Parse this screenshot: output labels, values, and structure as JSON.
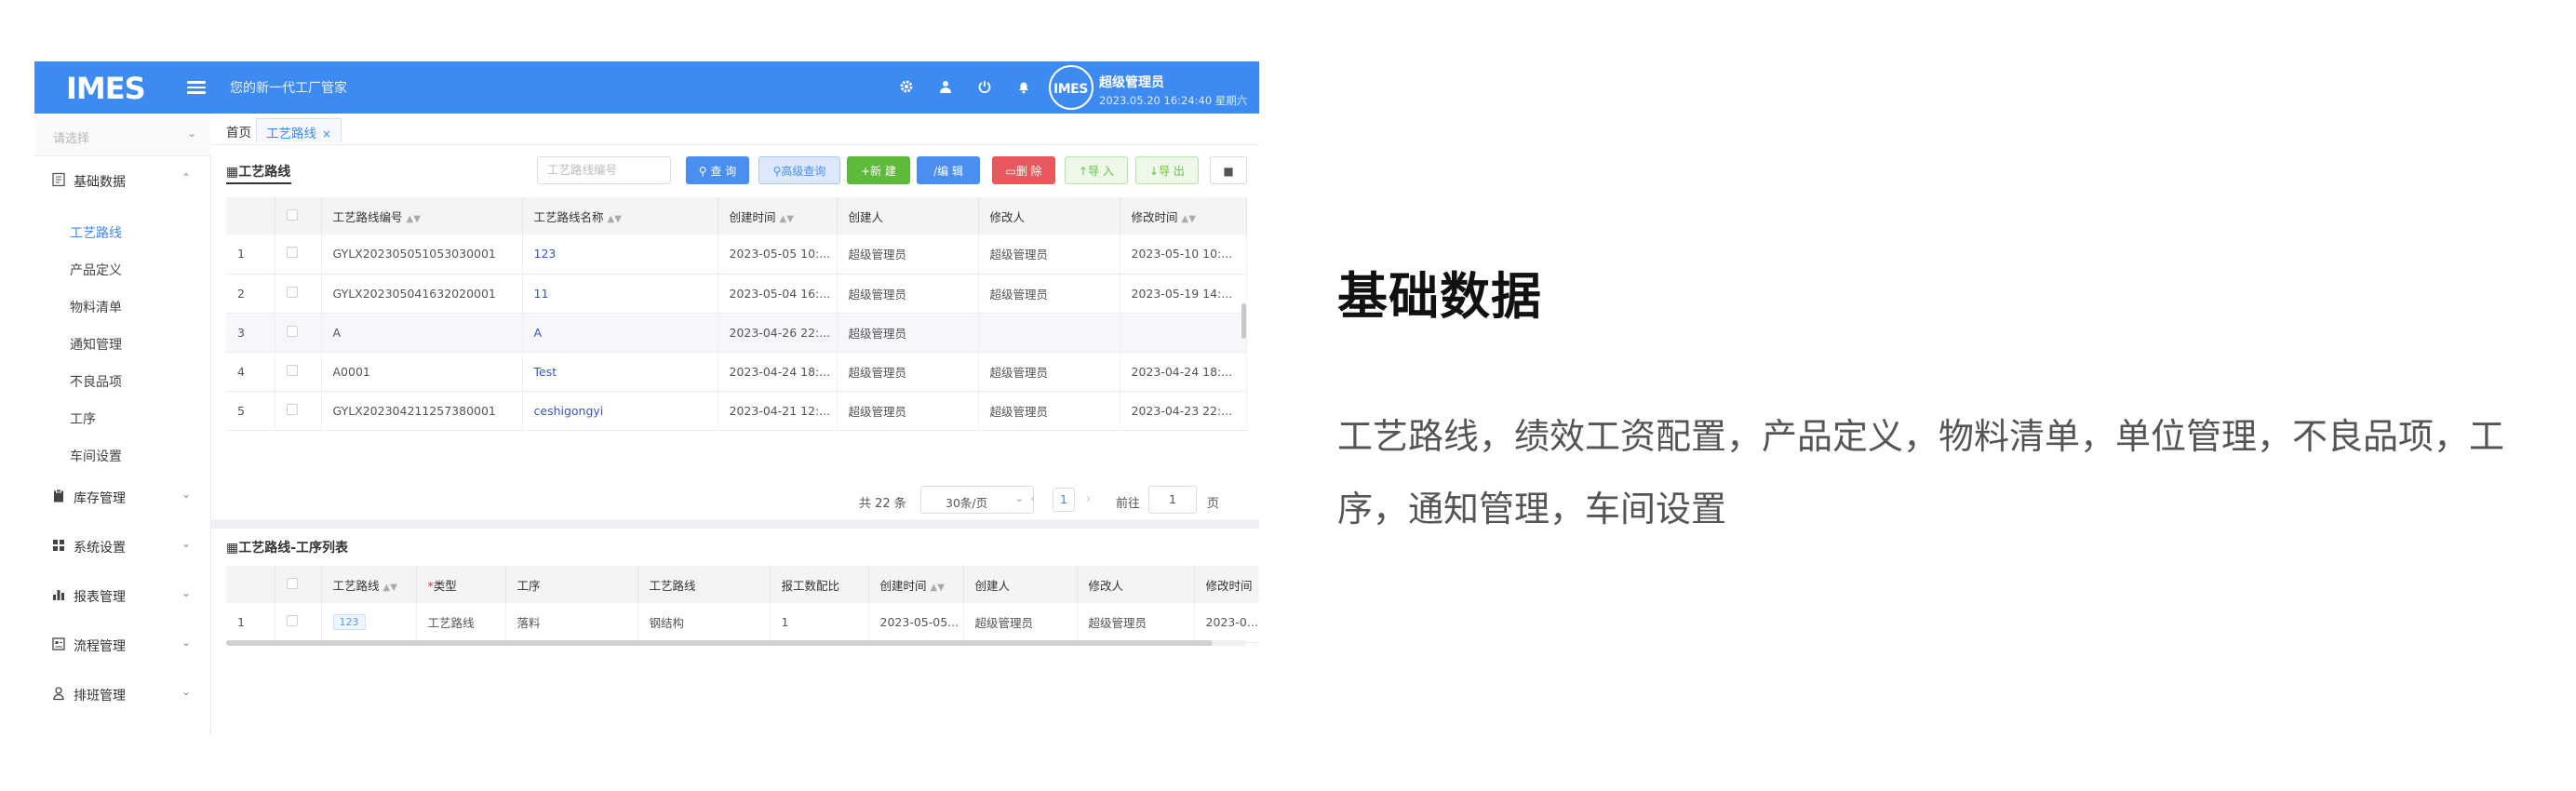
{
  "header": {
    "slogan": "您的新一代工厂管家",
    "user_name": "超级管理员",
    "datetime": "2023.05.20 16:24:40 星期六",
    "brand_color": "#3d8af1"
  },
  "sidebar": {
    "select_placeholder": "请选择",
    "groups": [
      {
        "label": "基础数据",
        "icon": "document-icon",
        "expanded": true,
        "items": [
          "工艺路线",
          "产品定义",
          "物料清单",
          "通知管理",
          "不良品项",
          "工序",
          "车间设置"
        ]
      },
      {
        "label": "库存管理",
        "icon": "clipboard-icon"
      },
      {
        "label": "系统设置",
        "icon": "grid-icon"
      },
      {
        "label": "报表管理",
        "icon": "bar-chart-icon"
      },
      {
        "label": "流程管理",
        "icon": "form-icon"
      },
      {
        "label": "排班管理",
        "icon": "person-icon"
      }
    ],
    "active_item": "工艺路线"
  },
  "tabs": {
    "home": "首页",
    "current": "工艺路线",
    "close": "×"
  },
  "panel": {
    "title": "工艺路线",
    "search_placeholder": "工艺路线编号",
    "buttons": {
      "query": "查 询",
      "advanced": "高级查询",
      "new": "新 建",
      "edit": "编 辑",
      "delete": "删 除",
      "import": "导 入",
      "export": "导 出"
    },
    "columns": [
      "工艺路线编号",
      "工艺路线名称",
      "创建时间",
      "创建人",
      "修改人",
      "修改时间"
    ],
    "rows": [
      {
        "no": "1",
        "code": "GYLX20230505105303000​1",
        "name": "123",
        "created": "2023-05-05 10:...",
        "creator": "超级管理员",
        "modifier": "超级管理员",
        "modified": "2023-05-10 10:..."
      },
      {
        "no": "2",
        "code": "GYLX202305041632020001",
        "name": "11",
        "created": "2023-05-04 16:...",
        "creator": "超级管理员",
        "modifier": "超级管理员",
        "modified": "2023-05-19 14:..."
      },
      {
        "no": "3",
        "code": "A",
        "name": "A",
        "created": "2023-04-26 22:...",
        "creator": "超级管理员",
        "modifier": "",
        "modified": ""
      },
      {
        "no": "4",
        "code": "A0001",
        "name": "Test",
        "created": "2023-04-24 18:...",
        "creator": "超级管理员",
        "modifier": "超级管理员",
        "modified": "2023-04-24 18:..."
      },
      {
        "no": "5",
        "code": "GYLX202304211257380001",
        "name": "ceshigongyi",
        "created": "2023-04-21 12:...",
        "creator": "超级管理员",
        "modifier": "超级管理员",
        "modified": "2023-04-23 22:..."
      }
    ],
    "pagination": {
      "total": "共 22 条",
      "page_size": "30条/页",
      "current": "1",
      "goto_label": "前往",
      "goto_value": "1",
      "unit": "页"
    }
  },
  "sub_panel": {
    "title": "工艺路线-工序列表",
    "columns": [
      "工艺路线",
      "类型",
      "工序",
      "工艺路线",
      "报工数配比",
      "创建时间",
      "创建人",
      "修改人",
      "修改时间"
    ],
    "rows": [
      {
        "no": "1",
        "route": "123",
        "type": "工艺路线",
        "process": "落料",
        "route2": "钢结构",
        "ratio": "1",
        "created": "2023-05-05...",
        "creator": "超级管理员",
        "modifier": "超级管理员",
        "modified": "2023-05..."
      }
    ]
  },
  "caption": {
    "heading": "基础数据",
    "description": "工艺路线，绩效工资配置，产品定义，物料清单，单位管理，不良品项，工序，通知管理，车间设置"
  }
}
